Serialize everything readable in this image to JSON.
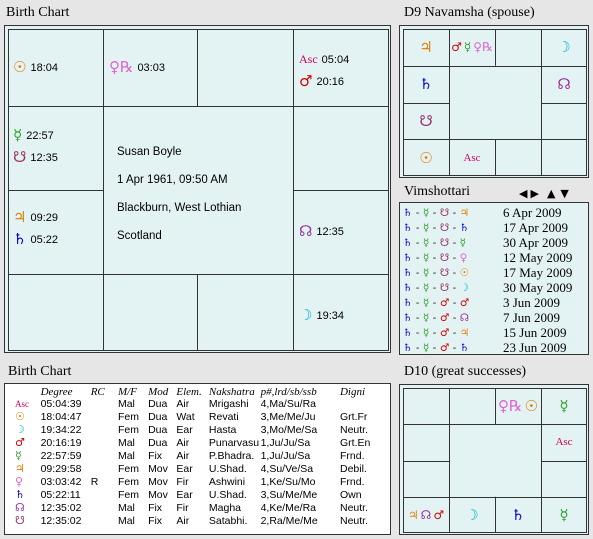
{
  "birth_chart": {
    "title": "Birth Chart",
    "center": [
      "Susan Boyle",
      "1 Apr 1961, 09:50 AM",
      "Blackburn, West Lothian",
      "Scotland"
    ],
    "houses": {
      "h1_left_top": [
        {
          "glyph": "☉",
          "color": "#e07a00",
          "label": "18:04"
        }
      ],
      "h_top_mid": [
        {
          "glyph": "♀℞",
          "color": "#e066cc",
          "label": "03:03"
        }
      ],
      "h_top_right": [
        {
          "glyph": "Asc",
          "color": "#d0005a",
          "label": "05:04"
        },
        {
          "glyph": "♂",
          "color": "#d00000",
          "label": "20:16"
        }
      ],
      "h_left_mid": [
        {
          "glyph": "☿",
          "color": "#2aa02a",
          "label": "22:57"
        },
        {
          "glyph": "☋",
          "color": "#993366",
          "label": "12:35"
        }
      ],
      "h_left_low": [
        {
          "glyph": "♃",
          "color": "#e08000",
          "label": "09:29"
        },
        {
          "glyph": "♄",
          "color": "#0000cc",
          "label": "05:22"
        }
      ],
      "h_right_mid": [
        {
          "glyph": "☊",
          "color": "#993399",
          "label": "12:35"
        }
      ],
      "h_right_low": [
        {
          "glyph": "☽",
          "color": "#00b8d0",
          "label": "19:34"
        }
      ]
    }
  },
  "d9": {
    "title": "D9 Navamsha  (spouse)",
    "cells": {
      "r0c0": [
        {
          "g": "♃",
          "c": "#e08000"
        }
      ],
      "r0c1": [
        {
          "g": "♂",
          "c": "#d00000"
        },
        {
          "g": "☿",
          "c": "#2aa02a"
        },
        {
          "g": "♀℞",
          "c": "#e066cc"
        }
      ],
      "r0c3": [
        {
          "g": "☽",
          "c": "#00b8d0"
        }
      ],
      "r1c0": [
        {
          "g": "♄",
          "c": "#0000cc"
        }
      ],
      "r1c3": [
        {
          "g": "☊",
          "c": "#993399"
        }
      ],
      "r2c0": [
        {
          "g": "☋",
          "c": "#993366"
        }
      ],
      "r3c0": [
        {
          "g": "☉",
          "c": "#e07a00"
        }
      ],
      "r3c1": [
        {
          "g": "Asc",
          "c": "#d0005a"
        }
      ]
    }
  },
  "vimshottari": {
    "title": "Vimshottari",
    "nav": [
      "◀",
      "▶",
      "▲",
      "▼"
    ],
    "rows": [
      {
        "syms": [
          [
            "♄",
            "#0000cc"
          ],
          [
            "☿",
            "#2aa02a"
          ],
          [
            "☋",
            "#993366"
          ],
          [
            "♃",
            "#e08000"
          ]
        ],
        "date": "6 Apr 2009"
      },
      {
        "syms": [
          [
            "♄",
            "#0000cc"
          ],
          [
            "☿",
            "#2aa02a"
          ],
          [
            "☋",
            "#993366"
          ],
          [
            "♄",
            "#0000cc"
          ]
        ],
        "date": "17 Apr 2009"
      },
      {
        "syms": [
          [
            "♄",
            "#0000cc"
          ],
          [
            "☿",
            "#2aa02a"
          ],
          [
            "☋",
            "#993366"
          ],
          [
            "☿",
            "#2aa02a"
          ]
        ],
        "date": "30 Apr 2009"
      },
      {
        "syms": [
          [
            "♄",
            "#0000cc"
          ],
          [
            "☿",
            "#2aa02a"
          ],
          [
            "☋",
            "#993366"
          ],
          [
            "♀",
            "#e066cc"
          ]
        ],
        "date": "12 May 2009"
      },
      {
        "syms": [
          [
            "♄",
            "#0000cc"
          ],
          [
            "☿",
            "#2aa02a"
          ],
          [
            "☋",
            "#993366"
          ],
          [
            "☉",
            "#e07a00"
          ]
        ],
        "date": "17 May 2009"
      },
      {
        "syms": [
          [
            "♄",
            "#0000cc"
          ],
          [
            "☿",
            "#2aa02a"
          ],
          [
            "☋",
            "#993366"
          ],
          [
            "☽",
            "#00b8d0"
          ]
        ],
        "date": "30 May 2009"
      },
      {
        "syms": [
          [
            "♄",
            "#0000cc"
          ],
          [
            "☿",
            "#2aa02a"
          ],
          [
            "♂",
            "#d00000"
          ],
          [
            "♂",
            "#d00000"
          ]
        ],
        "date": "3 Jun 2009"
      },
      {
        "syms": [
          [
            "♄",
            "#0000cc"
          ],
          [
            "☿",
            "#2aa02a"
          ],
          [
            "♂",
            "#d00000"
          ],
          [
            "☊",
            "#993399"
          ]
        ],
        "date": "7 Jun 2009"
      },
      {
        "syms": [
          [
            "♄",
            "#0000cc"
          ],
          [
            "☿",
            "#2aa02a"
          ],
          [
            "♂",
            "#d00000"
          ],
          [
            "♃",
            "#e08000"
          ]
        ],
        "date": "15 Jun 2009"
      },
      {
        "syms": [
          [
            "♄",
            "#0000cc"
          ],
          [
            "☿",
            "#2aa02a"
          ],
          [
            "♂",
            "#d00000"
          ],
          [
            "♄",
            "#0000cc"
          ]
        ],
        "date": "23 Jun 2009"
      }
    ]
  },
  "table": {
    "title": "Birth Chart",
    "headers": [
      "Degree",
      "RC",
      "M/F",
      "Mod",
      "Elem.",
      "Nakshatra",
      "p#,lrd/sb/ssb",
      "Digni"
    ],
    "rows": [
      {
        "g": "Asc",
        "c": "#d0005a",
        "cells": [
          "05:04:39",
          "",
          "Mal",
          "Dua",
          "Air",
          "Mrigashi",
          "4,Ma/Su/Ra",
          ""
        ]
      },
      {
        "g": "☉",
        "c": "#e07a00",
        "cells": [
          "18:04:47",
          "",
          "Fem",
          "Dua",
          "Wat",
          "Revati",
          "3,Me/Me/Ju",
          "Grt.Fr"
        ]
      },
      {
        "g": "☽",
        "c": "#00b8d0",
        "cells": [
          "19:34:22",
          "",
          "Fem",
          "Dua",
          "Ear",
          "Hasta",
          "3,Mo/Me/Sa",
          "Neutr."
        ]
      },
      {
        "g": "♂",
        "c": "#d00000",
        "cells": [
          "20:16:19",
          "",
          "Mal",
          "Dua",
          "Air",
          "Punarvasu",
          "1,Ju/Ju/Sa",
          "Grt.En"
        ]
      },
      {
        "g": "☿",
        "c": "#2aa02a",
        "cells": [
          "22:57:59",
          "",
          "Mal",
          "Fix",
          "Air",
          "P.Bhadra.",
          "1,Ju/Ju/Sa",
          "Frnd."
        ]
      },
      {
        "g": "♃",
        "c": "#e08000",
        "cells": [
          "09:29:58",
          "",
          "Fem",
          "Mov",
          "Ear",
          "U.Shad.",
          "4,Su/Ve/Sa",
          "Debil."
        ]
      },
      {
        "g": "♀",
        "c": "#e066cc",
        "cells": [
          "03:03:42",
          "R",
          "Fem",
          "Mov",
          "Fir",
          "Ashwini",
          "1,Ke/Su/Mo",
          "Frnd."
        ]
      },
      {
        "g": "♄",
        "c": "#0000cc",
        "cells": [
          "05:22:11",
          "",
          "Fem",
          "Mov",
          "Ear",
          "U.Shad.",
          "3,Su/Me/Me",
          "Own"
        ]
      },
      {
        "g": "☊",
        "c": "#993399",
        "cells": [
          "12:35:02",
          "",
          "Mal",
          "Fix",
          "Fir",
          "Magha",
          "4,Ke/Me/Ra",
          "Neutr."
        ]
      },
      {
        "g": "☋",
        "c": "#993366",
        "cells": [
          "12:35:02",
          "",
          "Mal",
          "Fix",
          "Air",
          "Satabhi.",
          "2,Ra/Me/Me",
          "Neutr."
        ]
      }
    ]
  },
  "d10": {
    "title": "D10  (great successes)",
    "cells": {
      "r0c2": [
        {
          "g": "♀℞",
          "c": "#e066cc"
        },
        {
          "g": "☉",
          "c": "#e07a00"
        }
      ],
      "r0c3": [
        {
          "g": "☿",
          "c": "#2aa02a"
        }
      ],
      "r1c3": [
        {
          "g": "Asc",
          "c": "#d0005a"
        }
      ],
      "r3c0": [
        {
          "g": "♃",
          "c": "#e08000"
        },
        {
          "g": "☊",
          "c": "#993399"
        },
        {
          "g": "♂",
          "c": "#d00000"
        }
      ],
      "r3c1": [
        {
          "g": "☽",
          "c": "#00b8d0"
        }
      ],
      "r3c2": [
        {
          "g": "♄",
          "c": "#0000cc"
        }
      ],
      "r3c3": [
        {
          "g": "☿",
          "c": "#2aa02a"
        }
      ]
    }
  }
}
